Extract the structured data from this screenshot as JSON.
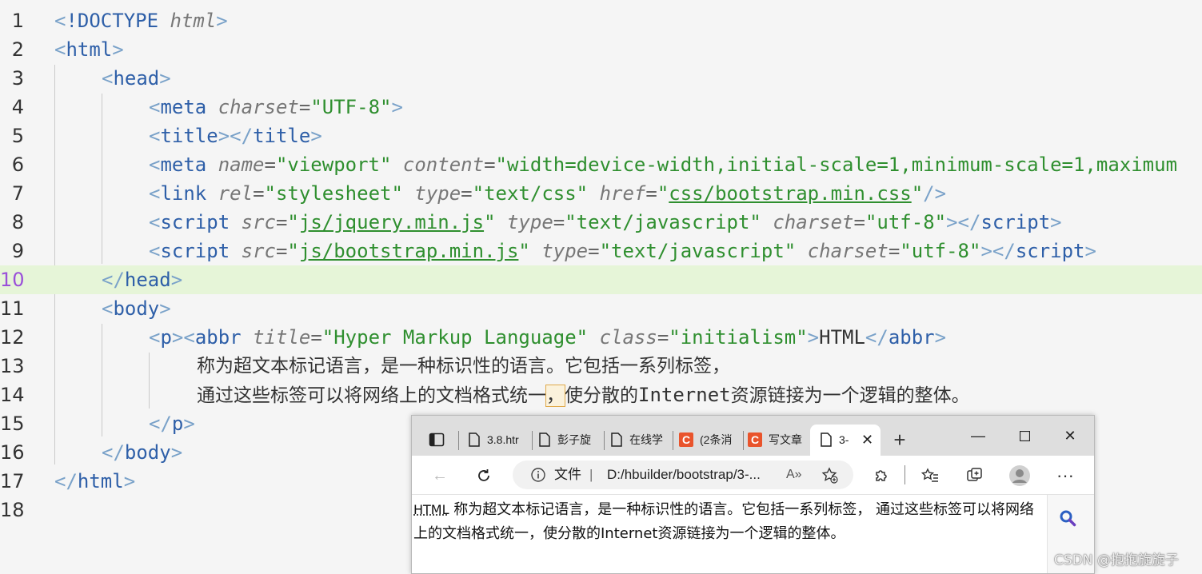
{
  "editor": {
    "current_line": 10,
    "line_numbers": [
      "1",
      "2",
      "3",
      "4",
      "5",
      "6",
      "7",
      "8",
      "9",
      "10",
      "11",
      "12",
      "13",
      "14",
      "15",
      "16",
      "17",
      "18"
    ],
    "lines": {
      "l1": {
        "doctype": "!DOCTYPE",
        "html": "html"
      },
      "l2": {
        "tag": "html"
      },
      "l3": {
        "tag": "head"
      },
      "l4": {
        "tag": "meta",
        "attr": "charset",
        "value": "UTF-8"
      },
      "l5": {
        "tag": "title"
      },
      "l6": {
        "tag": "meta",
        "attr1": "name",
        "val1": "viewport",
        "attr2": "content",
        "val2": "width=device-width,initial-scale=1,minimum-scale=1,maximum"
      },
      "l7": {
        "tag": "link",
        "attr1": "rel",
        "val1": "stylesheet",
        "attr2": "type",
        "val2": "text/css",
        "attr3": "href",
        "val3": "css/bootstrap.min.css"
      },
      "l8": {
        "tag": "script",
        "attr1": "src",
        "val1": "js/jquery.min.js",
        "attr2": "type",
        "val2": "text/javascript",
        "attr3": "charset",
        "val3": "utf-8"
      },
      "l9": {
        "tag": "script",
        "attr1": "src",
        "val1": "js/bootstrap.min.js",
        "attr2": "type",
        "val2": "text/javascript",
        "attr3": "charset",
        "val3": "utf-8"
      },
      "l10": {
        "tag": "head"
      },
      "l11": {
        "tag": "body"
      },
      "l12": {
        "tag1": "p",
        "tag2": "abbr",
        "attr1": "title",
        "val1": "Hyper Markup Language",
        "attr2": "class",
        "val2": "initialism",
        "text": "HTML"
      },
      "l13": {
        "text": "称为超文本标记语言，是一种标识性的语言。它包括一系列标签，"
      },
      "l14": {
        "text_a": "通过这些标签可以将网络上的文档格式统一",
        "comma": "，",
        "text_b": "使分散的",
        "text_c": "Internet",
        "text_d": "资源链接为一个逻辑的整体。"
      },
      "l15": {
        "tag": "p"
      },
      "l16": {
        "tag": "body"
      },
      "l17": {
        "tag": "html"
      }
    }
  },
  "browser": {
    "tabs": [
      {
        "label": "3.8.htr"
      },
      {
        "label": "彭子旋"
      },
      {
        "label": "在线学"
      },
      {
        "label": "(2条消"
      },
      {
        "label": "写文章"
      },
      {
        "label": "3-"
      }
    ],
    "address": {
      "info_label": "文件",
      "url": "D:/hbuilder/bootstrap/3-..."
    },
    "page": {
      "abbr": "HTML",
      "text": " 称为超文本标记语言，是一种标识性的语言。它包括一系列标签， 通过这些标签可以将网络上的文档格式统一，使分散的Internet资源链接为一个逻辑的整体。"
    }
  },
  "watermark": "CSDN @抱抱旋旋子",
  "colors": {
    "brand_csdn": "#e9542c",
    "current_line": "#e6f5d8",
    "tag": "#2e5fa8",
    "string": "#2f8f2f"
  }
}
